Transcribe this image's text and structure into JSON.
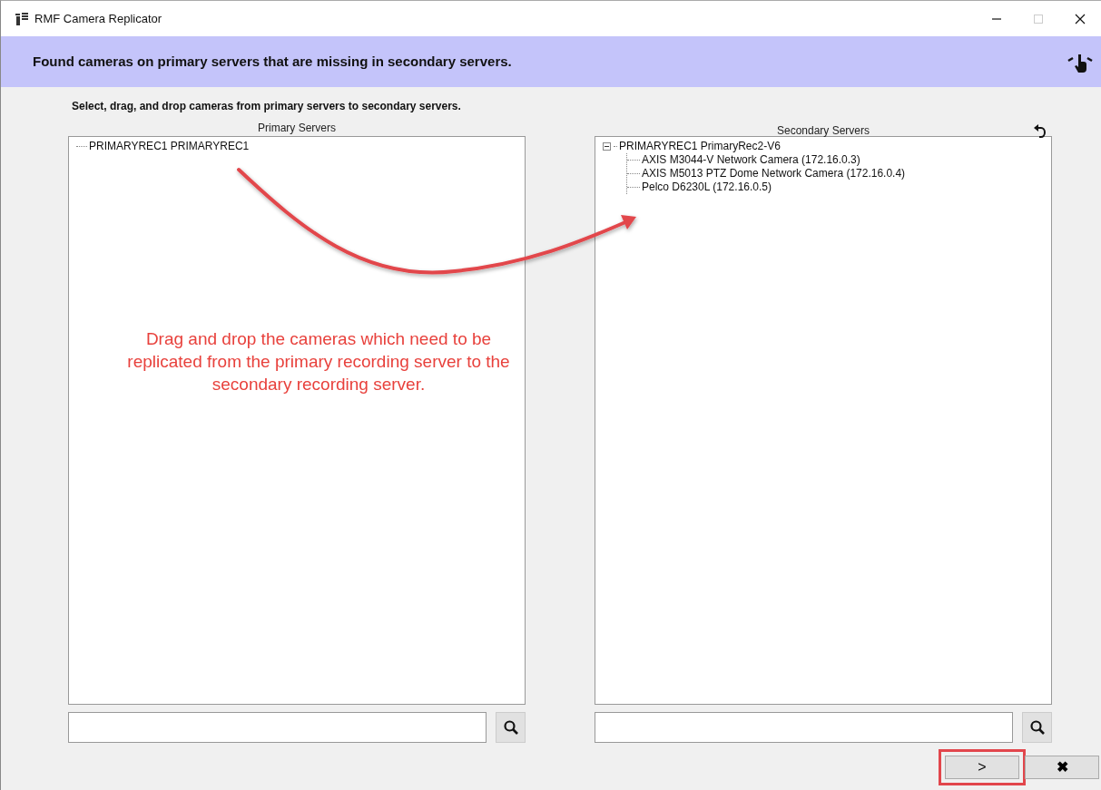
{
  "window": {
    "title": "RMF Camera Replicator"
  },
  "header": {
    "message": "Found cameras on primary servers that are missing in secondary servers."
  },
  "instruction": "Select, drag, and drop cameras from primary servers to secondary servers.",
  "panels": [
    {
      "title": "Primary Servers",
      "tree": [
        {
          "label": "PRIMARYREC1 PRIMARYREC1"
        }
      ]
    },
    {
      "title": "Secondary Servers",
      "tree": [
        {
          "label": "PRIMARYREC1 PrimaryRec2-V6",
          "expanded": true,
          "children": [
            {
              "label": "AXIS M3044-V Network Camera (172.16.0.3)"
            },
            {
              "label": "AXIS M5013 PTZ Dome Network Camera (172.16.0.4)"
            },
            {
              "label": "Pelco D6230L (172.16.0.5)"
            }
          ]
        }
      ]
    }
  ],
  "annotation": {
    "text": "Drag and drop the cameras which need to be replicated from the primary recording server to the secondary recording server."
  },
  "buttons": [
    {
      "kind": "next",
      "label": ">",
      "highlighted": true
    },
    {
      "kind": "cancel",
      "label": "✖",
      "highlighted": false
    }
  ]
}
